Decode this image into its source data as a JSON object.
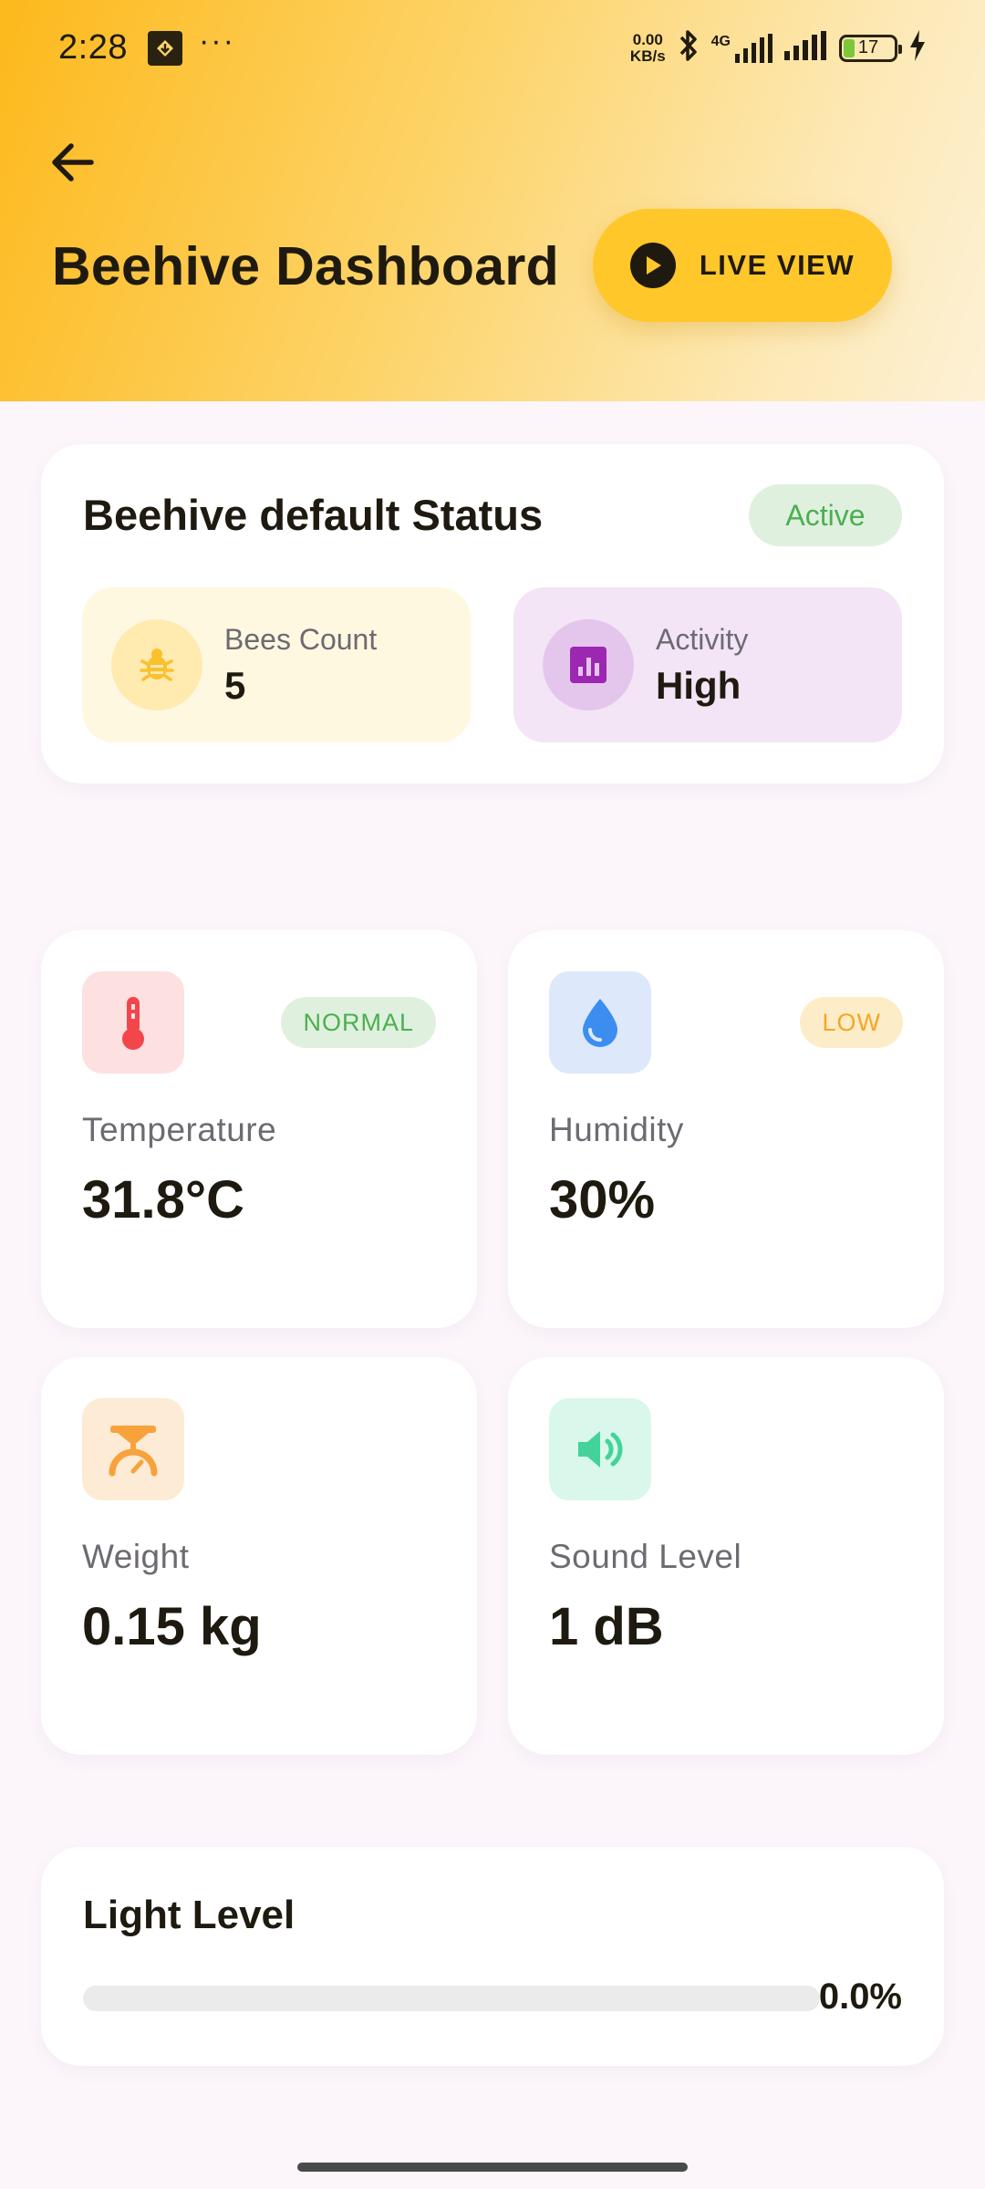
{
  "status_bar": {
    "time": "2:28",
    "more": "···",
    "speed_value": "0.00",
    "speed_unit": "KB/s",
    "network": "4G",
    "battery": "17",
    "battery_level": 0.17
  },
  "header": {
    "title": "Beehive Dashboard",
    "live_button": "LIVE VIEW",
    "gradient": [
      "#fdb91c",
      "#fdf1d6"
    ]
  },
  "status_card": {
    "title": "Beehive default Status",
    "badge": "Active",
    "bees": {
      "label": "Bees Count",
      "value": "5",
      "icon": "bug-icon"
    },
    "activity": {
      "label": "Activity",
      "value": "High",
      "icon": "bar-chart-icon"
    }
  },
  "metrics": {
    "temperature": {
      "label": "Temperature",
      "value": "31.8°C",
      "badge": "NORMAL",
      "icon": "thermometer-icon",
      "color": "#f2464b"
    },
    "humidity": {
      "label": "Humidity",
      "value": "30%",
      "badge": "LOW",
      "icon": "water-drop-icon",
      "color": "#3b8ef0"
    },
    "weight": {
      "label": "Weight",
      "value": "0.15 kg",
      "icon": "scale-icon",
      "color": "#f7a23b"
    },
    "sound": {
      "label": "Sound Level",
      "value": "1 dB",
      "icon": "volume-icon",
      "color": "#43d39a"
    }
  },
  "light": {
    "title": "Light Level",
    "value": "0.0%",
    "fraction": 0.0
  },
  "colors": {
    "accent": "#ffc72a",
    "background": "#fcf6fb",
    "active_green": "#4caf50",
    "low_orange": "#f5a623"
  }
}
